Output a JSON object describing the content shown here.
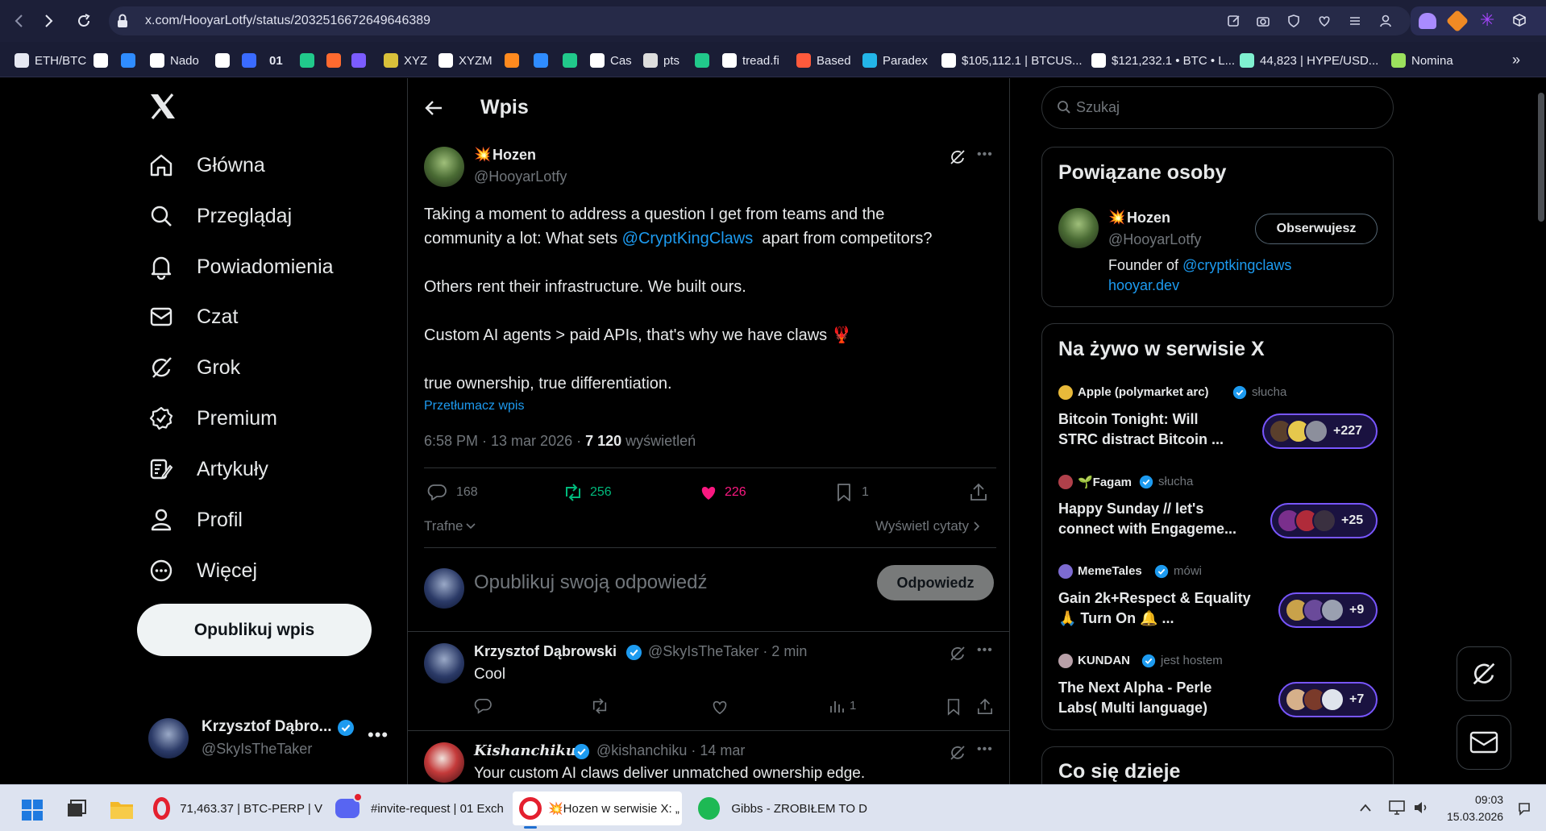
{
  "browser": {
    "url": "x.com/HooyarLotfy/status/2032516672649646389"
  },
  "bookmarks": [
    {
      "label": "ETH/BTC",
      "color": "#e6e8f2"
    },
    {
      "label": "",
      "color": "#ffffff"
    },
    {
      "label": "",
      "color": "#2f8cff"
    },
    {
      "label": "Nado",
      "color": "#ffffff"
    },
    {
      "label": "",
      "color": "#ffffff"
    },
    {
      "label": "",
      "color": "#3a6bff"
    },
    {
      "label": "01",
      "color": "#ffffff"
    },
    {
      "label": "",
      "color": "#21c98b"
    },
    {
      "label": "",
      "color": "#ff6a2f"
    },
    {
      "label": "",
      "color": "#7b5cff"
    },
    {
      "label": "XYZ",
      "color": "#d9c13a"
    },
    {
      "label": "XYZM",
      "color": "#ffffff"
    },
    {
      "label": "",
      "color": "#ff8a1f"
    },
    {
      "label": "",
      "color": "#2f8cff"
    },
    {
      "label": "",
      "color": "#21c98b"
    },
    {
      "label": "Cas",
      "color": "#ffffff"
    },
    {
      "label": "pts",
      "color": "#dddddd"
    },
    {
      "label": "",
      "color": "#21c98b"
    },
    {
      "label": "tread.fi",
      "color": "#ffffff"
    },
    {
      "label": "Based",
      "color": "#ff5a3c"
    },
    {
      "label": "Paradex",
      "color": "#23b5e8"
    },
    {
      "label": "$105,112.1 | BTCUS...",
      "color": "#ffffff"
    },
    {
      "label": "$121,232.1 • BTC • L...",
      "color": "#ffffff"
    },
    {
      "label": "44,823 | HYPE/USD...",
      "color": "#7ff0d0"
    },
    {
      "label": "Nomina",
      "color": "#9be15d"
    }
  ],
  "left_nav": {
    "items": [
      {
        "label": "Główna",
        "icon": "home-icon"
      },
      {
        "label": "Przeglądaj",
        "icon": "search-icon"
      },
      {
        "label": "Powiadomienia",
        "icon": "bell-icon"
      },
      {
        "label": "Czat",
        "icon": "mail-icon"
      },
      {
        "label": "Grok",
        "icon": "grok-icon"
      },
      {
        "label": "Premium",
        "icon": "premium-icon"
      },
      {
        "label": "Artykuły",
        "icon": "articles-icon"
      },
      {
        "label": "Profil",
        "icon": "profile-icon"
      },
      {
        "label": "Więcej",
        "icon": "more-icon"
      }
    ],
    "post_button": "Opublikuj wpis",
    "account": {
      "name": "Krzysztof Dąbro...",
      "handle": "@SkyIsTheTaker"
    }
  },
  "header": {
    "title": "Wpis"
  },
  "post": {
    "author_emoji": "💥",
    "author": "Hozen",
    "handle": "@HooyarLotfy",
    "text_1a": "Taking a moment to address a question I get from teams and the",
    "text_1b": "community a lot: What sets ",
    "mention": "@CryptKingClaws",
    "text_1c": "  apart from competitors?",
    "text_2": "Others rent their infrastructure. We built ours.",
    "text_3": "Custom AI agents > paid APIs, that's why we have claws 🦞",
    "text_4": "true ownership, true differentiation.",
    "translate": "Przetłumacz wpis",
    "time": "6:58 PM · 13 mar 2026 · ",
    "views_count": "7 120",
    "views_label": " wyświetleń",
    "replies": "168",
    "reposts": "256",
    "likes": "226",
    "bookmarks": "1",
    "sort_label": "Trafne",
    "quotes_label": "Wyświetl cytaty"
  },
  "reply_box": {
    "placeholder": "Opublikuj swoją odpowiedź",
    "button": "Odpowiedz"
  },
  "replies": [
    {
      "name": "Krzysztof Dąbrowski",
      "handle": "@SkyIsTheTaker · 2 min",
      "text": "Cool",
      "views": "1"
    },
    {
      "name": "𝑲𝒊𝒔𝒉𝒂𝒏𝒄𝒉𝒊𝒌𝒖",
      "handle": "@kishanchiku · 14 mar",
      "text": "Your custom AI claws deliver unmatched ownership edge."
    }
  ],
  "search": {
    "placeholder": "Szukaj"
  },
  "related": {
    "title": "Powiązane osoby",
    "emoji": "💥",
    "name": "Hozen",
    "handle": "@HooyarLotfy",
    "follow": "Obserwujesz",
    "bio_prefix": "Founder of ",
    "bio_link": "@cryptkingclaws",
    "bio_link2": "hooyar.dev"
  },
  "live": {
    "title": "Na żywo w serwisie X",
    "items": [
      {
        "host": "Apple (polymarket arc)",
        "status": "słucha",
        "title1": "Bitcoin Tonight:  Will",
        "title2": "STRC distract Bitcoin ...",
        "count": "+227"
      },
      {
        "host": "🌱Fagam",
        "status": "słucha",
        "title1": "Happy Sunday // let's",
        "title2": "connect with Engageme...",
        "count": "+25"
      },
      {
        "host": "MemeTales",
        "status": "mówi",
        "title1": "Gain 2k+Respect & Equality",
        "title2": "🙏 Turn On 🔔 ...",
        "count": "+9"
      },
      {
        "host": "KUNDAN",
        "status": "jest hostem",
        "title1": "The Next Alpha - Perle",
        "title2": "Labs( Multi language)",
        "count": "+7"
      }
    ]
  },
  "trending": {
    "title": "Co się dzieje"
  },
  "taskbar": {
    "items": [
      {
        "label": "71,463.37 | BTC-PERP | V"
      },
      {
        "label": "#invite-request | 01 Exch"
      },
      {
        "label": "💥Hozen w serwisie X: „"
      },
      {
        "label": "Gibbs - ZROBIŁEM TO D"
      }
    ],
    "time": "09:03",
    "date": "15.03.2026"
  }
}
